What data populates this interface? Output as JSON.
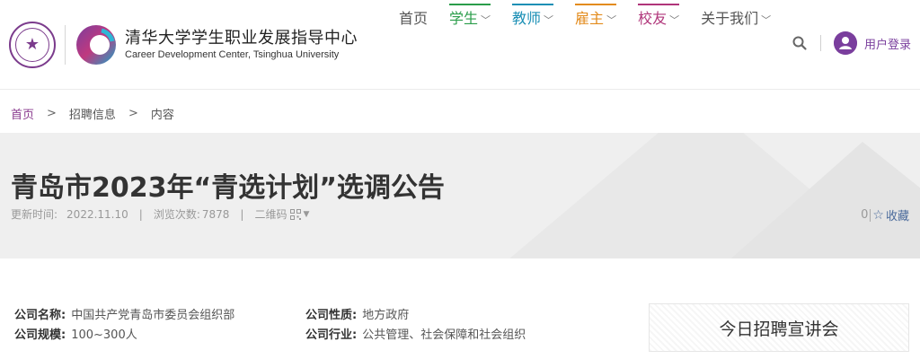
{
  "brand": {
    "cn": "清华大学学生职业发展指导中心",
    "en": "Career Development Center, Tsinghua University"
  },
  "nav": [
    {
      "label": "首页",
      "has_menu": false,
      "accent": ""
    },
    {
      "label": "学生",
      "has_menu": true,
      "accent": "#2a9d4a",
      "color": "#2a9d4a"
    },
    {
      "label": "教师",
      "has_menu": true,
      "accent": "#1a8fb5",
      "color": "#1a8fb5"
    },
    {
      "label": "雇主",
      "has_menu": true,
      "accent": "#e38b1c",
      "color": "#e38b1c"
    },
    {
      "label": "校友",
      "has_menu": true,
      "accent": "#b0357a",
      "color": "#b0357a"
    },
    {
      "label": "关于我们",
      "has_menu": true,
      "accent": "",
      "color": "#555555"
    }
  ],
  "tools": {
    "user_login": "用户登录"
  },
  "breadcrumb": {
    "home": "首页",
    "separator": ">",
    "section": "招聘信息",
    "current": "内容"
  },
  "article": {
    "title": "青岛市2023年“青选计划”选调公告",
    "updated_label": "更新时间:",
    "updated_value": "2022.11.10",
    "views_label": "浏览次数:",
    "views_value": "7878",
    "qr_label": "二维码",
    "fav_count": "0",
    "fav_label": "收藏",
    "meta_sep": "|"
  },
  "company": {
    "name_label": "公司名称:",
    "name_value": "中国共产党青岛市委员会组织部",
    "size_label": "公司规模:",
    "size_value": "100~300人",
    "type_label": "公司性质:",
    "type_value": "地方政府",
    "industry_label": "公司行业:",
    "industry_value": "公共管理、社会保障和社会组织"
  },
  "today_box": "今日招聘宣讲会",
  "colors": {
    "brand_purple": "#7a3e9d",
    "link_blue": "#4a6a9b"
  }
}
